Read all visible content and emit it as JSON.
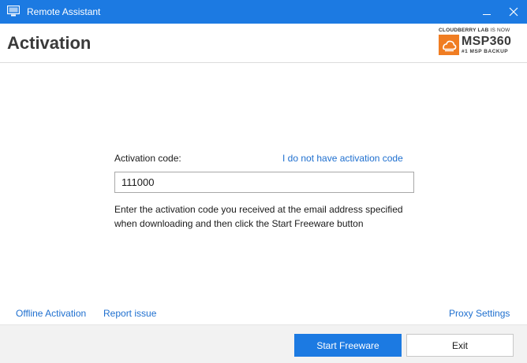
{
  "window": {
    "title": "Remote Assistant",
    "icon": "monitor-icon",
    "controls": [
      "minimize-icon",
      "close-icon"
    ]
  },
  "header": {
    "title": "Activation",
    "logo": {
      "tagline_brand": "CLOUDBERRY LAB",
      "tagline_suffix": "IS NOW",
      "brand": "MSP360",
      "subtitle": "#1 MSP BACKUP",
      "color": "#f07d22"
    }
  },
  "form": {
    "code_label": "Activation code:",
    "no_code_link": "I do not have activation code",
    "code_value": "111000",
    "help_text": "Enter the activation code you received at the email address specified when downloading and then click the Start Freeware button"
  },
  "footer": {
    "offline_activation": "Offline Activation",
    "report_issue": "Report issue",
    "proxy_settings": "Proxy Settings"
  },
  "buttons": {
    "start": "Start Freeware",
    "exit": "Exit"
  },
  "colors": {
    "accent": "#1c7ae2",
    "link": "#1e6fcf"
  }
}
